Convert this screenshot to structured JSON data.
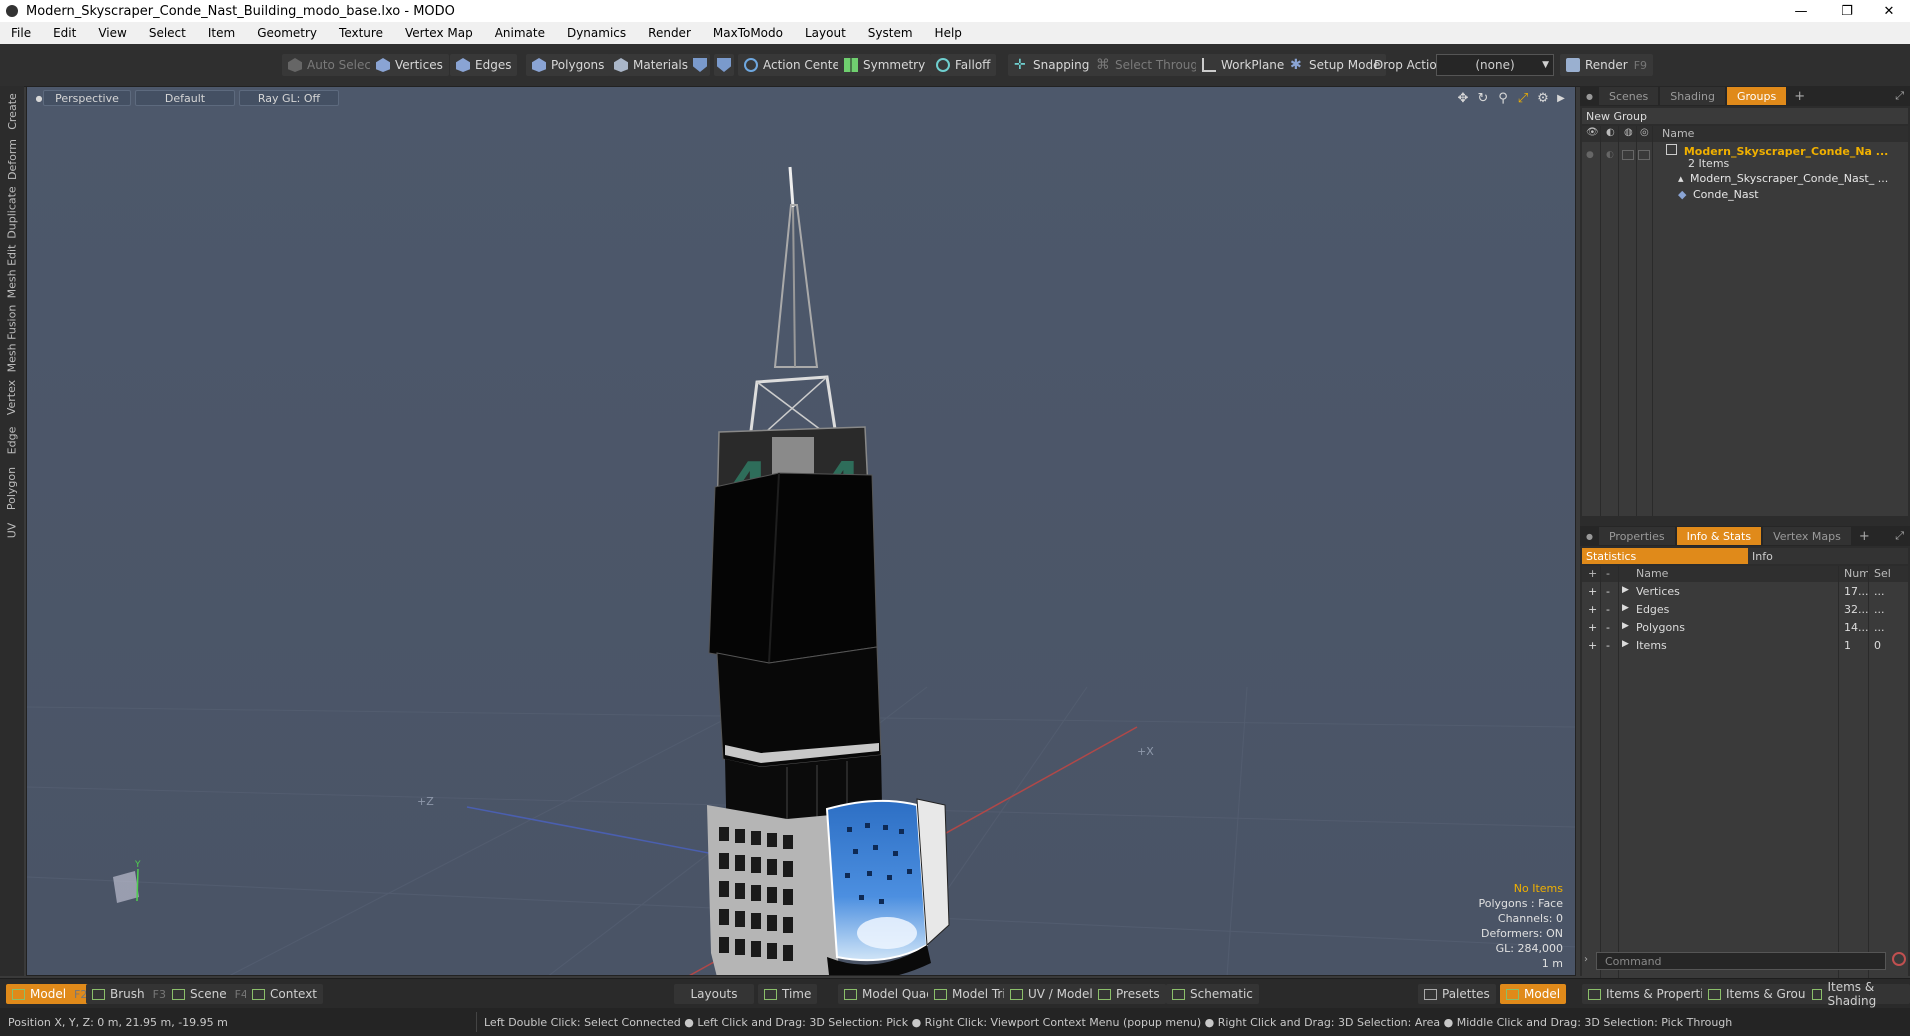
{
  "window": {
    "title": "Modern_Skyscraper_Conde_Nast_Building_modo_base.lxo - MODO",
    "controls": [
      "—",
      "❐",
      "✕"
    ]
  },
  "menu": [
    "File",
    "Edit",
    "View",
    "Select",
    "Item",
    "Geometry",
    "Texture",
    "Vertex Map",
    "Animate",
    "Dynamics",
    "Render",
    "MaxToModo",
    "Layout",
    "System",
    "Help"
  ],
  "toolbar": {
    "auto_select": "Auto Select",
    "vertices": "Vertices",
    "edges": "Edges",
    "polygons": "Polygons",
    "materials": "Materials",
    "action_center": "Action Center",
    "symmetry": "Symmetry",
    "falloff": "Falloff",
    "snapping": "Snapping",
    "select_through": "Select Through",
    "workplane": "WorkPlane",
    "setup_mode": "Setup Mode",
    "drop_action": "Drop Action",
    "drop_value": "(none)",
    "render": "Render",
    "render_key": "F9"
  },
  "left_tabs": [
    "Create",
    "Deform",
    "Duplicate",
    "Mesh Edit",
    "Mesh Fusion",
    "Vertex",
    "Edge",
    "Polygon",
    "UV"
  ],
  "viewport": {
    "view": "Perspective",
    "shading": "Default",
    "raygl": "Ray GL: Off",
    "axis_z": "+Z",
    "axis_x": "+X",
    "axis_y": "Y",
    "info": {
      "no_items": "No Items",
      "polygons": "Polygons : Face",
      "channels": "Channels: 0",
      "deformers": "Deformers: ON",
      "gl": "GL: 284,000",
      "scale": "1 m"
    },
    "signage": "4"
  },
  "groups_panel": {
    "tabs": [
      "Scenes",
      "Shading",
      "Groups"
    ],
    "active_tab": "Groups",
    "new_group": "New Group",
    "col_name": "Name",
    "root_item": "Modern_Skyscraper_Conde_Na ...",
    "root_count": "2 Items",
    "child1": "Modern_Skyscraper_Conde_Nast_ ...",
    "child2": "Conde_Nast"
  },
  "stats_panel": {
    "tabs": [
      "Properties",
      "Info & Stats",
      "Vertex Maps"
    ],
    "active_tab": "Info & Stats",
    "sub_tabs": [
      "Statistics",
      "Info"
    ],
    "col_name": "Name",
    "col_num": "Num",
    "col_sel": "Sel",
    "rows": [
      {
        "name": "Vertices",
        "num": "17...",
        "sel": "..."
      },
      {
        "name": "Edges",
        "num": "32...",
        "sel": "..."
      },
      {
        "name": "Polygons",
        "num": "14...",
        "sel": "..."
      },
      {
        "name": "Items",
        "num": "1",
        "sel": "0"
      }
    ],
    "command_placeholder": "Command"
  },
  "bottom_bar": {
    "model": "Model",
    "model_key": "F2",
    "brush": "Brush",
    "brush_key": "F3",
    "scene": "Scene",
    "scene_key": "F4",
    "context": "Context",
    "layouts": "Layouts",
    "time": "Time",
    "model_quad": "Model Quad",
    "model_tri": "Model Tri",
    "uv_model": "UV / Model",
    "presets": "Presets",
    "schematic": "Schematic",
    "palettes": "Palettes",
    "model2": "Model",
    "items_properties": "Items & Properties",
    "items_groups": "Items & Groups",
    "items_shading": "Items & Shading"
  },
  "status": {
    "position": "Position X, Y, Z:  0 m, 21.95 m, -19.95 m",
    "hints": "Left Double Click: Select Connected ● Left Click and Drag: 3D Selection: Pick ● Right Click: Viewport Context Menu (popup menu) ● Right Click and Drag: 3D Selection: Area ● Middle Click and Drag: 3D Selection: Pick Through"
  },
  "colors": {
    "accent": "#e08a1a",
    "viewport_bg": "#4e586a",
    "highlight_text": "#f0b000"
  }
}
